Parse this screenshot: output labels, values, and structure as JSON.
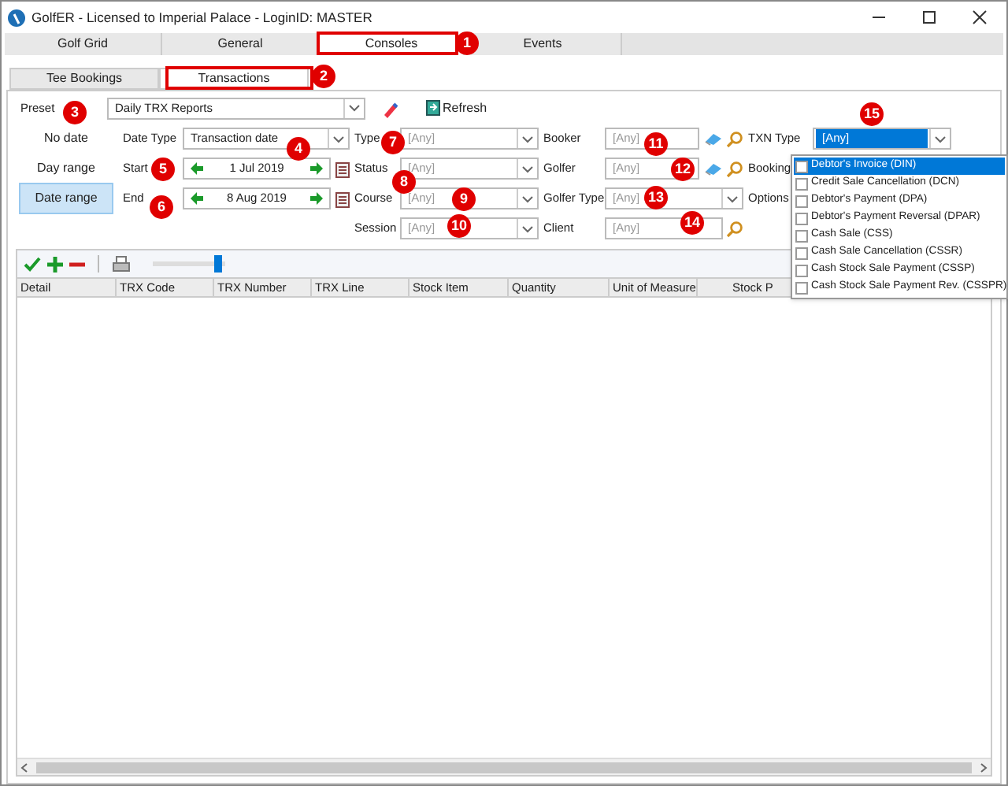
{
  "window": {
    "title": "GolfER - Licensed to Imperial Palace - LoginID: MASTER"
  },
  "tabs": [
    {
      "label": "Golf Grid",
      "selected": false
    },
    {
      "label": "General",
      "selected": false
    },
    {
      "label": "Consoles",
      "selected": true
    },
    {
      "label": "Events",
      "selected": false
    }
  ],
  "subtabs": [
    {
      "label": "Tee Bookings",
      "selected": false
    },
    {
      "label": "Transactions",
      "selected": true
    }
  ],
  "preset": {
    "label": "Preset",
    "value": "Daily TRX Reports",
    "refresh": "Refresh"
  },
  "date_modes": [
    {
      "label": "No date",
      "selected": false
    },
    {
      "label": "Day range",
      "selected": false
    },
    {
      "label": "Date range",
      "selected": true
    }
  ],
  "date_fields": [
    {
      "label": "Date Type",
      "kind": "combo",
      "value": "Transaction date"
    },
    {
      "label": "Start",
      "kind": "date",
      "value": "1 Jul 2019"
    },
    {
      "label": "End",
      "kind": "date",
      "value": "8 Aug 2019"
    }
  ],
  "filters_1": [
    {
      "label": "Type",
      "kind": "combo",
      "placeholder": "[Any]"
    },
    {
      "label": "Status",
      "kind": "combo",
      "placeholder": "[Any]"
    },
    {
      "label": "Course",
      "kind": "combo",
      "placeholder": "[Any]"
    },
    {
      "label": "Session",
      "kind": "combo",
      "placeholder": "[Any]"
    }
  ],
  "filters_2": [
    {
      "label": "Booker",
      "kind": "lookup",
      "placeholder": "[Any]"
    },
    {
      "label": "Golfer",
      "kind": "lookup",
      "placeholder": "[Any]"
    },
    {
      "label": "Golfer Type",
      "kind": "combo",
      "placeholder": "[Any]"
    },
    {
      "label": "Client",
      "kind": "search",
      "placeholder": "[Any]"
    }
  ],
  "filters_3": [
    {
      "label": "TXN Type",
      "kind": "combo",
      "value": "[Any]"
    },
    {
      "label": "Booking"
    },
    {
      "label": "Options"
    }
  ],
  "txn_type_options": [
    {
      "label": "Debtor's Invoice (DIN)",
      "checked": false,
      "selected": true
    },
    {
      "label": "Credit Sale Cancellation (DCN)",
      "checked": false,
      "selected": false
    },
    {
      "label": "Debtor's Payment (DPA)",
      "checked": false,
      "selected": false
    },
    {
      "label": "Debtor's Payment Reversal (DPAR)",
      "checked": false,
      "selected": false
    },
    {
      "label": "Cash Sale (CSS)",
      "checked": false,
      "selected": false
    },
    {
      "label": "Cash Sale Cancellation (CSSR)",
      "checked": false,
      "selected": false
    },
    {
      "label": "Cash Stock Sale Payment (CSSP)",
      "checked": false,
      "selected": false
    },
    {
      "label": "Cash Stock Sale Payment Rev. (CSSPR)",
      "checked": false,
      "selected": false
    }
  ],
  "toolbar": {
    "zoom": {
      "level": 0.95
    }
  },
  "table": {
    "columns": [
      "Detail",
      "TRX Code",
      "TRX Number",
      "TRX Line",
      "Stock Item",
      "Quantity",
      "Unit of Measure",
      "Stock P"
    ]
  },
  "callouts": [
    "1",
    "2",
    "3",
    "4",
    "5",
    "6",
    "7",
    "8",
    "9",
    "10",
    "11",
    "12",
    "13",
    "14",
    "15"
  ]
}
